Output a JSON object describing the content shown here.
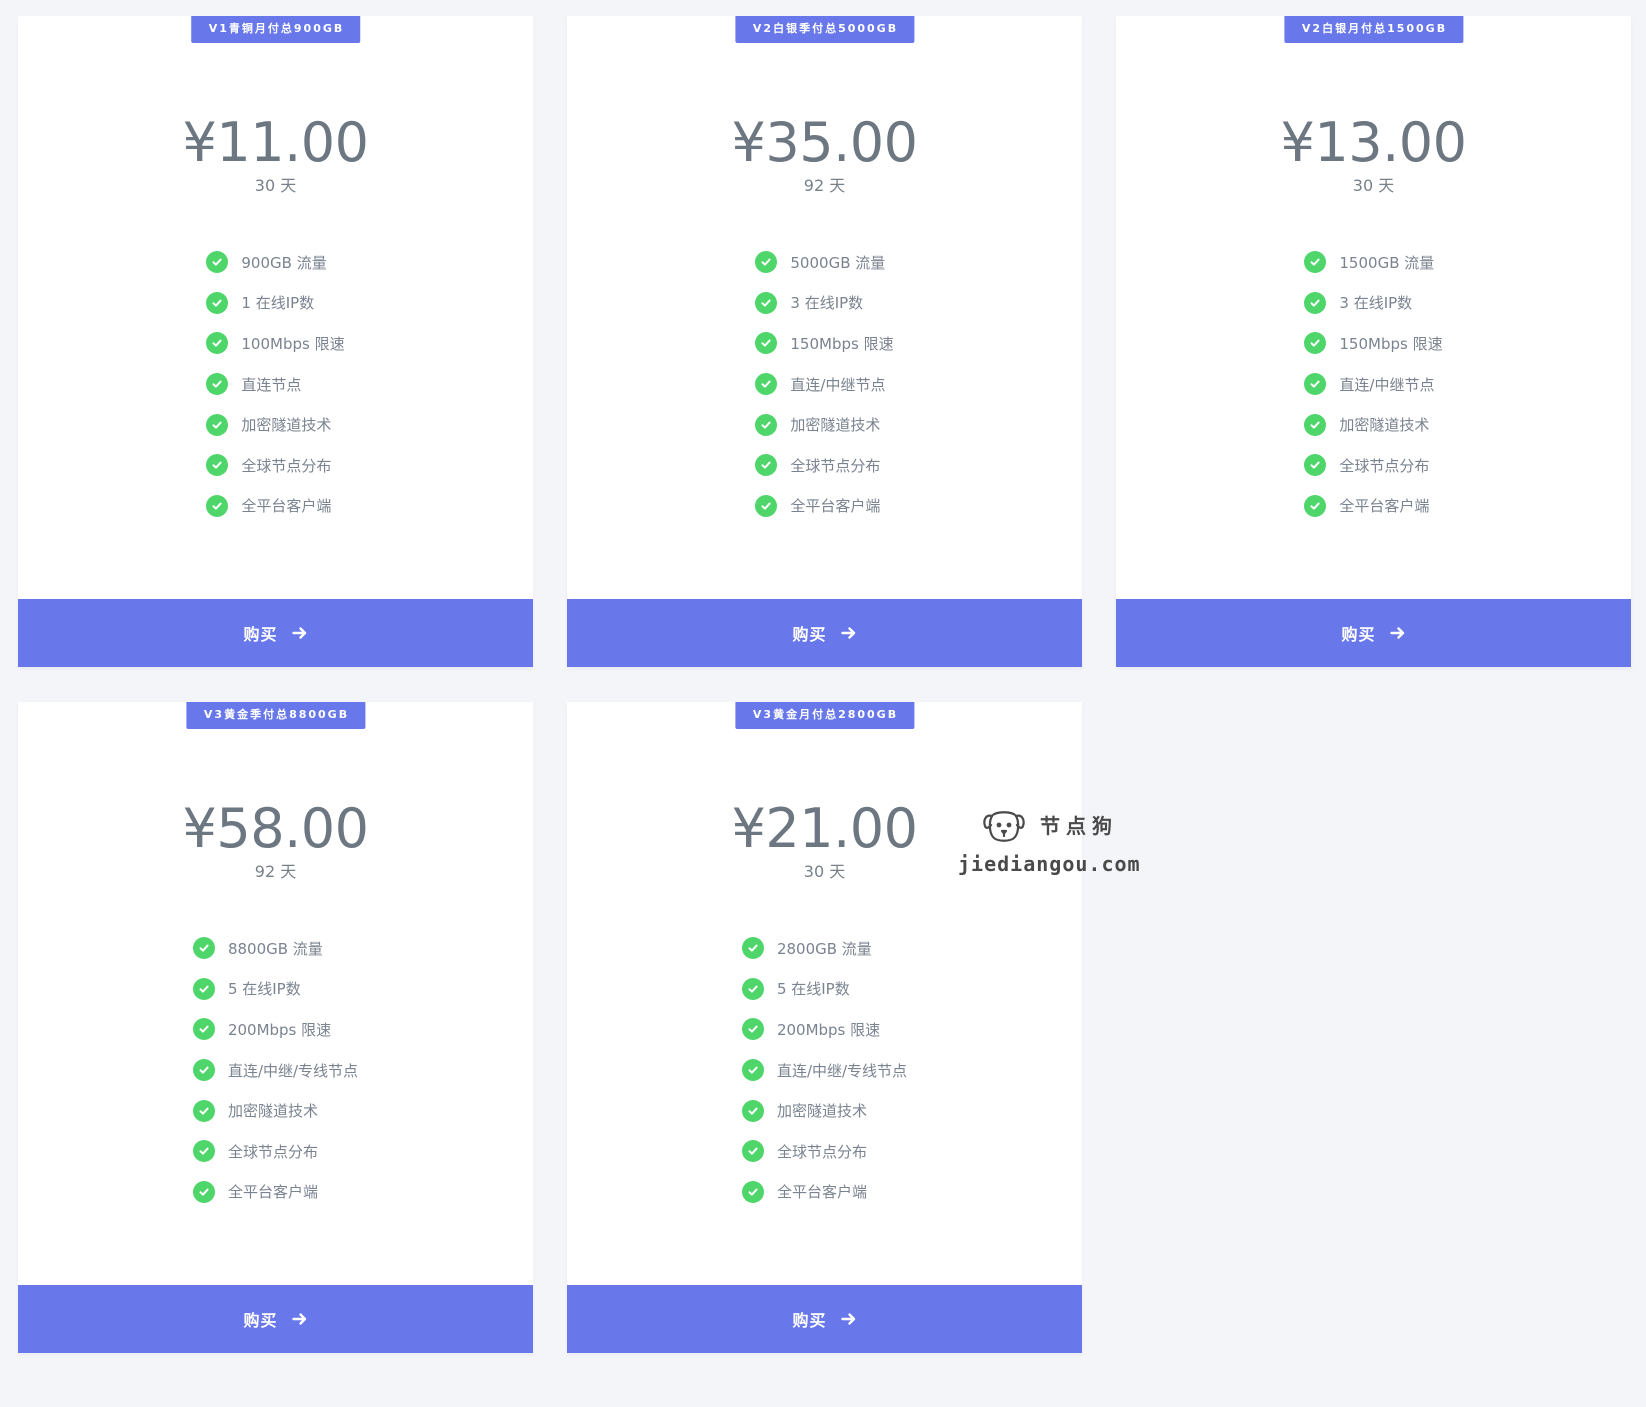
{
  "colors": {
    "page_background": "#f4f5f9",
    "card_background": "#ffffff",
    "accent": "#6878ea",
    "check": "#4fd66a",
    "price_text": "#6d7781",
    "feature_text": "#7a8390"
  },
  "icons": {
    "feature": "check-circle-icon",
    "buy": "arrow-right-icon"
  },
  "plans": [
    {
      "tag": "V1青铜月付总900GB",
      "price": "¥11.00",
      "period": "30 天",
      "features": [
        "900GB 流量",
        "1 在线IP数",
        "100Mbps 限速",
        "直连节点",
        "加密隧道技术",
        "全球节点分布",
        "全平台客户端"
      ],
      "buy_label": "购买"
    },
    {
      "tag": "V2白银季付总5000GB",
      "price": "¥35.00",
      "period": "92 天",
      "features": [
        "5000GB 流量",
        "3 在线IP数",
        "150Mbps 限速",
        "直连/中继节点",
        "加密隧道技术",
        "全球节点分布",
        "全平台客户端"
      ],
      "buy_label": "购买"
    },
    {
      "tag": "V2白银月付总1500GB",
      "price": "¥13.00",
      "period": "30 天",
      "features": [
        "1500GB 流量",
        "3 在线IP数",
        "150Mbps 限速",
        "直连/中继节点",
        "加密隧道技术",
        "全球节点分布",
        "全平台客户端"
      ],
      "buy_label": "购买"
    },
    {
      "tag": "V3黄金季付总8800GB",
      "price": "¥58.00",
      "period": "92 天",
      "features": [
        "8800GB 流量",
        "5 在线IP数",
        "200Mbps 限速",
        "直连/中继/专线节点",
        "加密隧道技术",
        "全球节点分布",
        "全平台客户端"
      ],
      "buy_label": "购买"
    },
    {
      "tag": "V3黄金月付总2800GB",
      "price": "¥21.00",
      "period": "30 天",
      "features": [
        "2800GB 流量",
        "5 在线IP数",
        "200Mbps 限速",
        "直连/中继/专线节点",
        "加密隧道技术",
        "全球节点分布",
        "全平台客户端"
      ],
      "buy_label": "购买"
    }
  ],
  "watermark": {
    "brand": "节点狗",
    "url": "jiediangou.com",
    "icon": "dog-icon"
  }
}
